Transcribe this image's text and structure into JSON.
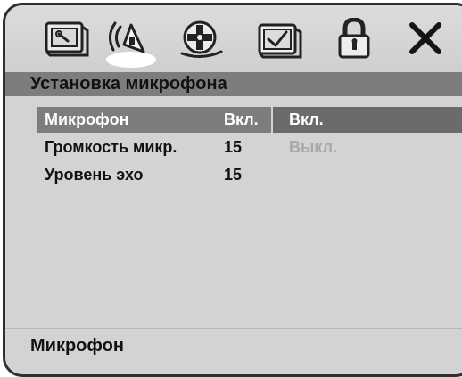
{
  "toolbar": {
    "icons": [
      {
        "name": "general-settings-icon",
        "active": false
      },
      {
        "name": "speaker-icon",
        "active": true
      },
      {
        "name": "film-reel-icon",
        "active": false
      },
      {
        "name": "preference-check-icon",
        "active": false
      },
      {
        "name": "lock-icon",
        "active": false
      },
      {
        "name": "close-icon",
        "active": false
      }
    ]
  },
  "page": {
    "title": "Установка микрофона"
  },
  "menu": {
    "rows": [
      {
        "label": "Микрофон",
        "value": "Вкл.",
        "selected": true
      },
      {
        "label": "Громкость микр.",
        "value": "15",
        "selected": false
      },
      {
        "label": "Уровень эхо",
        "value": "15",
        "selected": false
      }
    ],
    "options": [
      {
        "label": "Вкл.",
        "state": "selected"
      },
      {
        "label": "Выкл.",
        "state": "disabled"
      }
    ]
  },
  "footer": {
    "hint": "Микрофон"
  },
  "colors": {
    "panel_bg": "#d3d3d3",
    "title_bar": "#7d7d7d",
    "selected_option": "#6b6b6b",
    "disabled_text": "#a9a9a9",
    "frame": "#2f2f2f"
  }
}
